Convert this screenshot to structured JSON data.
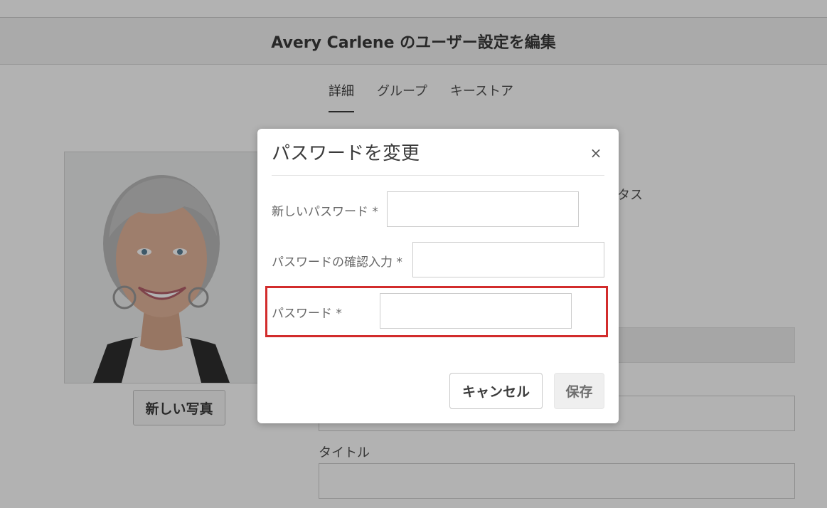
{
  "page": {
    "title": "Avery Carlene のユーザー設定を編集",
    "tabs": [
      {
        "label": "詳細",
        "active": true
      },
      {
        "label": "グループ",
        "active": false
      },
      {
        "label": "キーストア",
        "active": false
      }
    ],
    "new_photo_label": "新しい写真",
    "status_label_partial": "ータス",
    "title_field_label": "タイトル"
  },
  "dialog": {
    "title": "パスワードを変更",
    "close_glyph": "×",
    "fields": [
      {
        "label": "新しいパスワード",
        "required_mark": "*",
        "value": ""
      },
      {
        "label": "パスワードの確認入力",
        "required_mark": "*",
        "value": ""
      },
      {
        "label": "パスワード",
        "required_mark": "*",
        "value": "",
        "highlighted": true
      }
    ],
    "cancel_label": "キャンセル",
    "save_label": "保存"
  },
  "colors": {
    "highlight": "#d22c2c",
    "overlay": "rgba(0,0,0,0.30)"
  },
  "icons": {
    "close": "close-icon"
  }
}
